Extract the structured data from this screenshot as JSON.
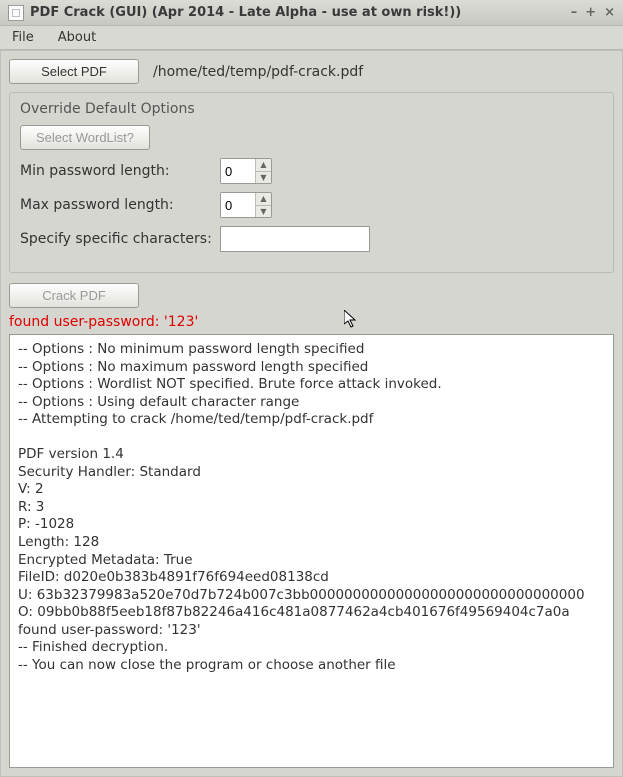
{
  "window": {
    "title": "PDF Crack (GUI) (Apr 2014 - Late Alpha - use at own risk!))"
  },
  "menubar": {
    "file": "File",
    "about": "About"
  },
  "toolbar": {
    "select_pdf_label": "Select PDF",
    "filepath": "/home/ted/temp/pdf-crack.pdf"
  },
  "options": {
    "group_title": "Override Default Options",
    "select_wordlist_label": "Select WordList?",
    "min_label": "Min password length:",
    "min_value": "0",
    "max_label": "Max password length:",
    "max_value": "0",
    "chars_label": "Specify specific characters:",
    "chars_value": ""
  },
  "actions": {
    "crack_label": "Crack PDF"
  },
  "status": "found user-password: '123'",
  "output_lines": [
    "-- Options : No minimum password length specified",
    "-- Options : No maximum password length specified",
    "-- Options : Wordlist NOT specified. Brute force attack invoked.",
    "-- Options : Using default character range",
    "-- Attempting to crack /home/ted/temp/pdf-crack.pdf",
    "",
    "PDF version 1.4",
    "Security Handler: Standard",
    "V: 2",
    "R: 3",
    "P: -1028",
    "Length: 128",
    "Encrypted Metadata: True",
    "FileID: d020e0b383b4891f76f694eed08138cd",
    "U: 63b32379983a520e70d7b724b007c3bb00000000000000000000000000000000",
    "O: 09bb0b88f5eeb18f87b82246a416c481a0877462a4cb401676f49569404c7a0a",
    "found user-password: '123'",
    "-- Finished decryption.",
    "-- You can now close the program or choose another file"
  ]
}
